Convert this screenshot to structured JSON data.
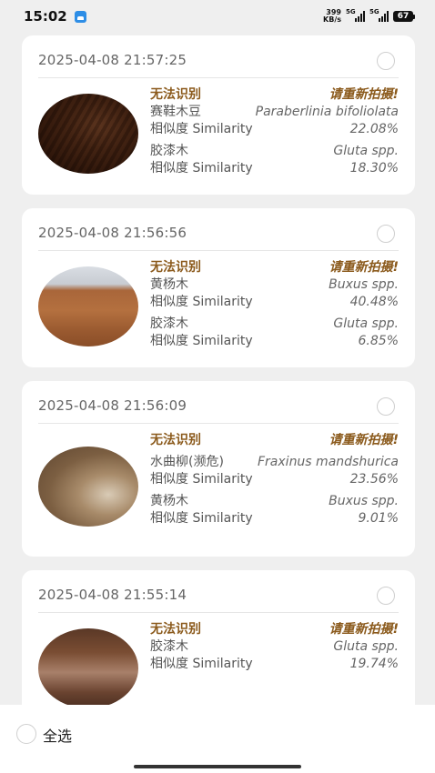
{
  "status_bar": {
    "time": "15:02",
    "net_speed_value": "399",
    "net_speed_unit": "KB/s",
    "signal1_label": "5G",
    "signal2_label": "5G",
    "battery": "67"
  },
  "records": [
    {
      "time": "2025-04-08 21:57:25",
      "warn_left": "无法识别",
      "warn_right": "请重新拍摄!",
      "matches": [
        {
          "cn": "赛鞋木豆",
          "sci": "Paraberlinia bifoliolata",
          "sim_label": "相似度 Similarity",
          "pct": "22.08%"
        },
        {
          "cn": "胶漆木",
          "sci": "Gluta spp.",
          "sim_label": "相似度 Similarity",
          "pct": "18.30%"
        }
      ]
    },
    {
      "time": "2025-04-08 21:56:56",
      "warn_left": "无法识别",
      "warn_right": "请重新拍摄!",
      "matches": [
        {
          "cn": "黄杨木",
          "sci": "Buxus spp.",
          "sim_label": "相似度 Similarity",
          "pct": "40.48%"
        },
        {
          "cn": "胶漆木",
          "sci": "Gluta spp.",
          "sim_label": "相似度 Similarity",
          "pct": "6.85%"
        }
      ]
    },
    {
      "time": "2025-04-08 21:56:09",
      "warn_left": "无法识别",
      "warn_right": "请重新拍摄!",
      "matches": [
        {
          "cn": "水曲柳(濒危)",
          "sci": "Fraxinus mandshurica",
          "sim_label": "相似度 Similarity",
          "pct": "23.56%"
        },
        {
          "cn": "黄杨木",
          "sci": "Buxus spp.",
          "sim_label": "相似度 Similarity",
          "pct": "9.01%"
        }
      ]
    },
    {
      "time": "2025-04-08 21:55:14",
      "warn_left": "无法识别",
      "warn_right": "请重新拍摄!",
      "matches": [
        {
          "cn": "胶漆木",
          "sci": "Gluta spp.",
          "sim_label": "相似度 Similarity",
          "pct": "19.74%"
        }
      ]
    }
  ],
  "bottom_bar": {
    "select_all_label": "全选"
  }
}
